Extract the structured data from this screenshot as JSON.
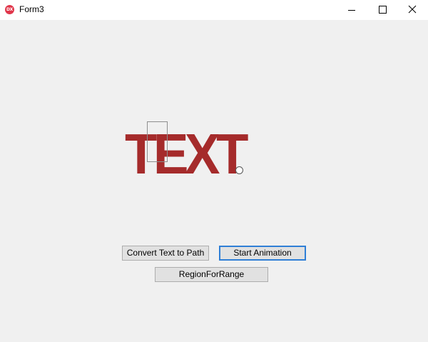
{
  "window": {
    "title": "Form3",
    "icon_text": "DX",
    "controls": [
      "minimize-icon",
      "maximize-icon",
      "close-icon"
    ]
  },
  "canvas": {
    "text": "TEXT",
    "text_color": "#a52b2b"
  },
  "buttons": {
    "convert_label": "Convert Text to Path",
    "animation_label": "Start Animation",
    "region_label": "RegionForRange"
  },
  "colors": {
    "focus_border": "#2f7fd6",
    "background": "#f0f0f0"
  }
}
